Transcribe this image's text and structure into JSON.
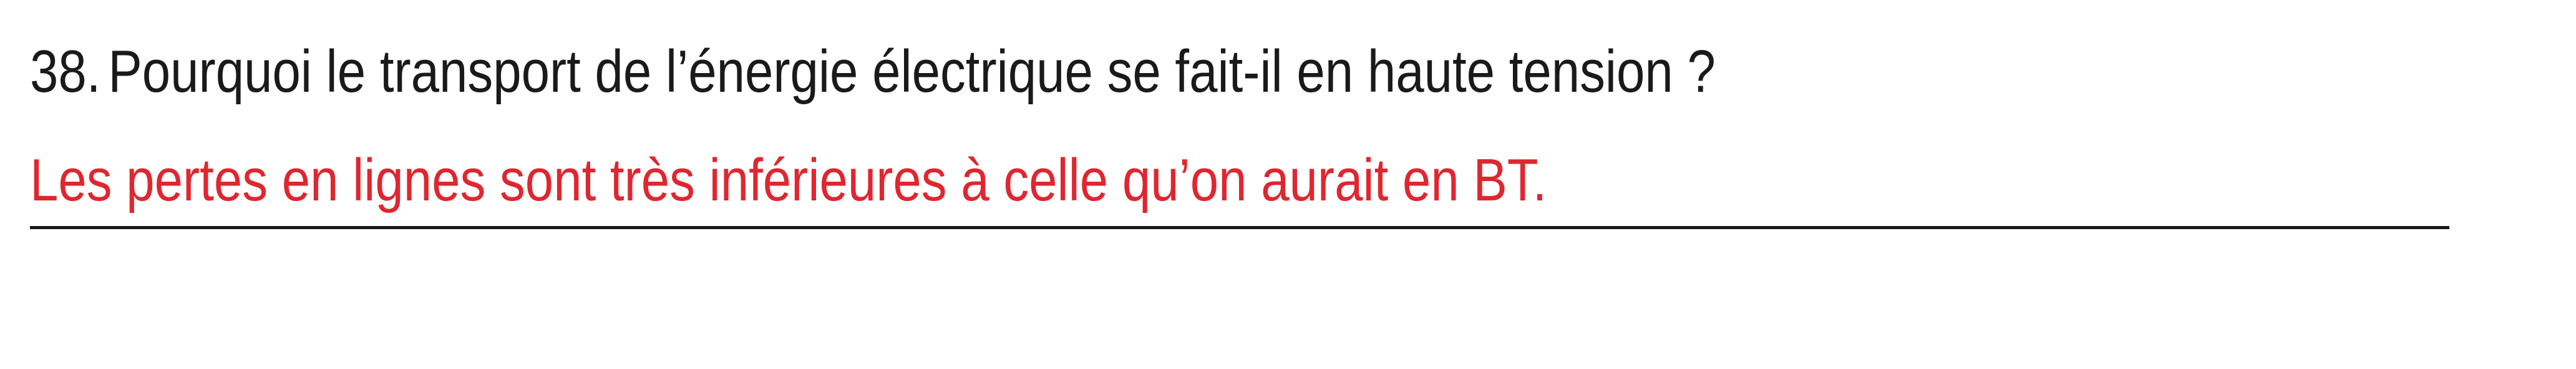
{
  "question": {
    "number": "38.",
    "text": "Pourquoi le transport de l’énergie électrique se fait-il en haute tension ?"
  },
  "answer": {
    "text": "Les pertes en lignes sont très inférieures à celle qu’on aurait en BT."
  },
  "colors": {
    "question_text": "#1a1a1a",
    "answer_text": "#e0262f",
    "rule_line": "#1a1a1a"
  }
}
